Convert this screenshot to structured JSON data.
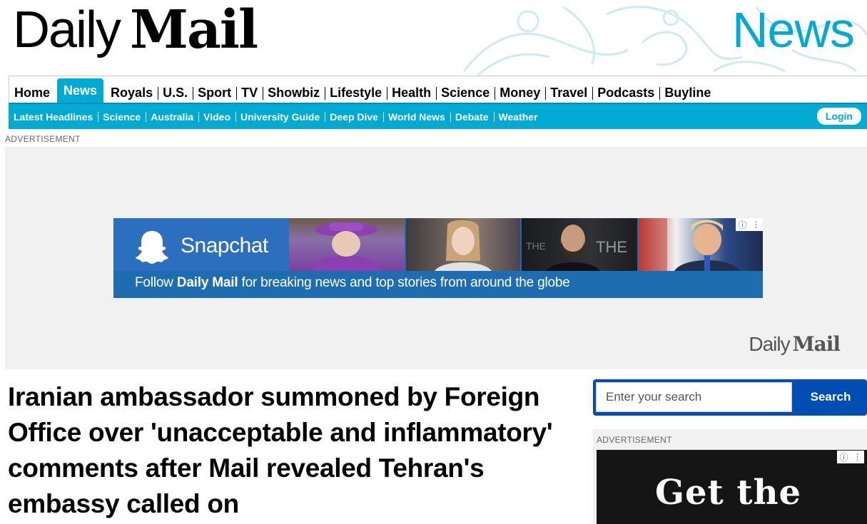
{
  "brand": {
    "daily": "Daily",
    "mail": "Mail",
    "channel": "News"
  },
  "nav": {
    "primary": [
      "Home",
      "News",
      "Royals",
      "U.S.",
      "Sport",
      "TV",
      "Showbiz",
      "Lifestyle",
      "Health",
      "Science",
      "Money",
      "Travel",
      "Podcasts",
      "Buyline"
    ],
    "active": "News",
    "secondary": [
      "Latest Headlines",
      "Science",
      "Australia",
      "Video",
      "University Guide",
      "Deep Dive",
      "World News",
      "Debate",
      "Weather"
    ],
    "login": "Login"
  },
  "top_ad": {
    "label": "ADVERTISEMENT",
    "app_name": "Snapchat",
    "tagline_pre": "Follow ",
    "tagline_brand": "Daily Mail",
    "tagline_post": " for breaking news and top stories from around the globe",
    "logo_daily": "Daily",
    "logo_mail": "Mail"
  },
  "article": {
    "headline": "Iranian ambassador summoned by Foreign Office over 'unacceptable and inflammatory' comments after Mail revealed Tehran's embassy called on"
  },
  "search": {
    "placeholder": "Enter your search",
    "button": "Search"
  },
  "side_ad": {
    "label": "ADVERTISEMENT",
    "text": "Get the"
  },
  "colors": {
    "accent": "#00aad2",
    "search_blue": "#004db3",
    "snap_blue": "#1f6db1"
  },
  "icons": {
    "adchoices": "info-icon",
    "ad_menu": "kebab-menu-icon",
    "snapchat": "ghost-icon"
  }
}
